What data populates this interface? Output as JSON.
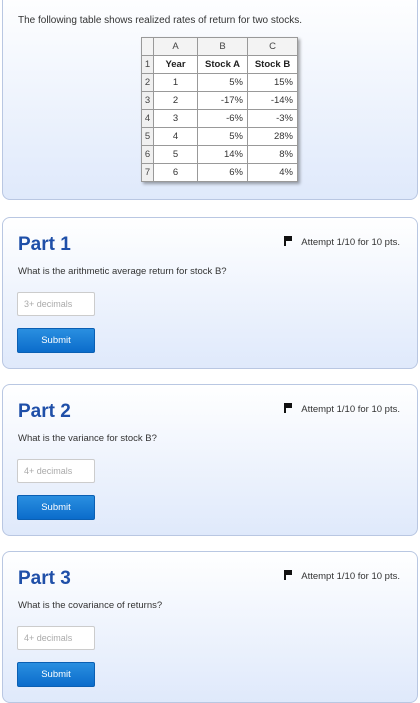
{
  "intro": {
    "text": "The following table shows realized rates of return for two stocks.",
    "table": {
      "columns": [
        "A",
        "B",
        "C"
      ],
      "rows": [
        {
          "row": "1",
          "cells": [
            "Year",
            "Stock A",
            "Stock B"
          ]
        },
        {
          "row": "2",
          "cells": [
            "1",
            "5%",
            "15%"
          ]
        },
        {
          "row": "3",
          "cells": [
            "2",
            "-17%",
            "-14%"
          ]
        },
        {
          "row": "4",
          "cells": [
            "3",
            "-6%",
            "-3%"
          ]
        },
        {
          "row": "5",
          "cells": [
            "4",
            "5%",
            "28%"
          ]
        },
        {
          "row": "6",
          "cells": [
            "5",
            "14%",
            "8%"
          ]
        },
        {
          "row": "7",
          "cells": [
            "6",
            "6%",
            "4%"
          ]
        }
      ]
    }
  },
  "parts": [
    {
      "title": "Part 1",
      "attempt": "Attempt 1/10 for 10 pts.",
      "question": "What is the arithmetic average return for stock B?",
      "placeholder": "3+ decimals",
      "submit": "Submit"
    },
    {
      "title": "Part 2",
      "attempt": "Attempt 1/10 for 10 pts.",
      "question": "What is the variance for stock B?",
      "placeholder": "4+ decimals",
      "submit": "Submit"
    },
    {
      "title": "Part 3",
      "attempt": "Attempt 1/10 for 10 pts.",
      "question": "What is the covariance of returns?",
      "placeholder": "4+ decimals",
      "submit": "Submit"
    }
  ],
  "icons": {
    "attempt": "flag-icon"
  },
  "colors": {
    "title": "#1f4fa8",
    "button": "#0b6ccb",
    "card_gradient_end": "#dfe9fb"
  }
}
